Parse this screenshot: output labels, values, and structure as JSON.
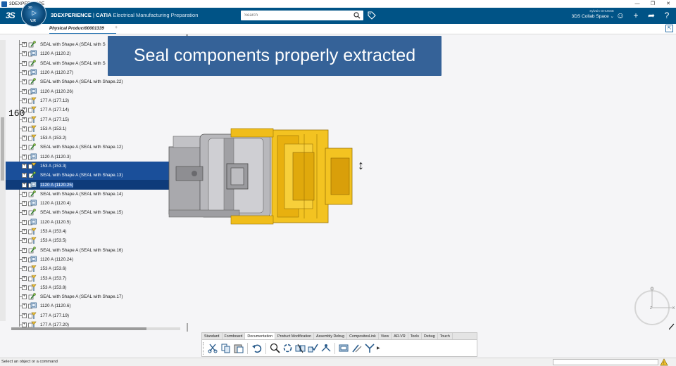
{
  "os_bar": {
    "title": "3DEXPERIENCE"
  },
  "header": {
    "brand_bold": "3DEXPERIENCE",
    "brand_sep": " | ",
    "brand_catia": "CATIA",
    "app_name": " Electrical Manufacturing Preparation",
    "compass_version": "V.R",
    "search_placeholder": "Search",
    "user_name": "Sylvain GHUSSE",
    "collab_space": "3DS Collab Space"
  },
  "tab": {
    "label": "Physical Product00001339",
    "add": "+"
  },
  "caption": "Seal components properly extracted",
  "side_number": "160",
  "colors": {
    "header_bg": "#005386",
    "caption_bg": "#2e5d95",
    "selection": "#1a4f9a",
    "model_yellow": "#f3c321",
    "model_gray": "#a9a9ad"
  },
  "tree": [
    {
      "label": "SEAL with Shape A (SEAL with S",
      "icon": "seal-icon",
      "state": ""
    },
    {
      "label": "1120 A (1120.2)",
      "icon": "part-icon",
      "state": ""
    },
    {
      "label": "SEAL with Shape A (SEAL with S",
      "icon": "seal-icon",
      "state": ""
    },
    {
      "label": "1120 A (1120.27)",
      "icon": "part-icon",
      "state": ""
    },
    {
      "label": "SEAL with Shape A (SEAL with Shape.22)",
      "icon": "seal-icon",
      "state": ""
    },
    {
      "label": "1120 A (1120.26)",
      "icon": "part-icon",
      "state": ""
    },
    {
      "label": "177 A (177.13)",
      "icon": "terminal-icon",
      "state": ""
    },
    {
      "label": "177 A (177.14)",
      "icon": "terminal-icon",
      "state": ""
    },
    {
      "label": "177 A (177.15)",
      "icon": "terminal-icon",
      "state": ""
    },
    {
      "label": "153 A (153.1)",
      "icon": "terminal-icon",
      "state": ""
    },
    {
      "label": "153 A (153.2)",
      "icon": "terminal-icon",
      "state": ""
    },
    {
      "label": "SEAL with Shape A (SEAL with Shape.12)",
      "icon": "seal-icon",
      "state": ""
    },
    {
      "label": "1120 A (1120.3)",
      "icon": "part-icon",
      "state": ""
    },
    {
      "label": "153 A (153.3)",
      "icon": "terminal-icon",
      "state": "sel"
    },
    {
      "label": "SEAL with Shape A (SEAL with Shape.13)",
      "icon": "seal-icon",
      "state": "sel"
    },
    {
      "label": "1120 A (1120.25)",
      "icon": "part-icon",
      "state": "sel2"
    },
    {
      "label": "SEAL with Shape A (SEAL with Shape.14)",
      "icon": "seal-icon",
      "state": ""
    },
    {
      "label": "1120 A (1120.4)",
      "icon": "part-icon",
      "state": ""
    },
    {
      "label": "SEAL with Shape A (SEAL with Shape.15)",
      "icon": "seal-icon",
      "state": ""
    },
    {
      "label": "1120 A (1120.5)",
      "icon": "part-icon",
      "state": ""
    },
    {
      "label": "153 A (153.4)",
      "icon": "terminal-icon",
      "state": ""
    },
    {
      "label": "153 A (153.5)",
      "icon": "terminal-icon",
      "state": ""
    },
    {
      "label": "SEAL with Shape A (SEAL with Shape.16)",
      "icon": "seal-icon",
      "state": ""
    },
    {
      "label": "1120 A (1120.24)",
      "icon": "part-icon",
      "state": ""
    },
    {
      "label": "153 A (153.6)",
      "icon": "terminal-icon",
      "state": ""
    },
    {
      "label": "153 A (153.7)",
      "icon": "terminal-icon",
      "state": ""
    },
    {
      "label": "153 A (153.8)",
      "icon": "terminal-icon",
      "state": ""
    },
    {
      "label": "SEAL with Shape A (SEAL with Shape.17)",
      "icon": "seal-icon",
      "state": ""
    },
    {
      "label": "1120 A (1120.6)",
      "icon": "part-icon",
      "state": ""
    },
    {
      "label": "177 A (177.19)",
      "icon": "terminal-icon",
      "state": ""
    },
    {
      "label": "177 A (177.20)",
      "icon": "terminal-icon",
      "state": ""
    }
  ],
  "action_bar": {
    "tabs": [
      "Standard",
      "Formboard",
      "Documentation",
      "Product Modification",
      "Assembly Debug",
      "CompositesLink",
      "View",
      "AR-VR",
      "Tools",
      "Debug",
      "Touch"
    ],
    "active_tab": "Documentation",
    "tools": [
      "cut-icon",
      "copy-icon",
      "paste-icon",
      "undo-icon",
      "zoom-icon",
      "update-icon",
      "constraint-icon",
      "check-icon",
      "split-icon",
      "layer-icon",
      "measure-icon",
      "bundle-icon"
    ]
  },
  "status": {
    "message": "Select an object or a command"
  },
  "compass3d": {
    "z_label": "Z",
    "x_label": "X"
  }
}
